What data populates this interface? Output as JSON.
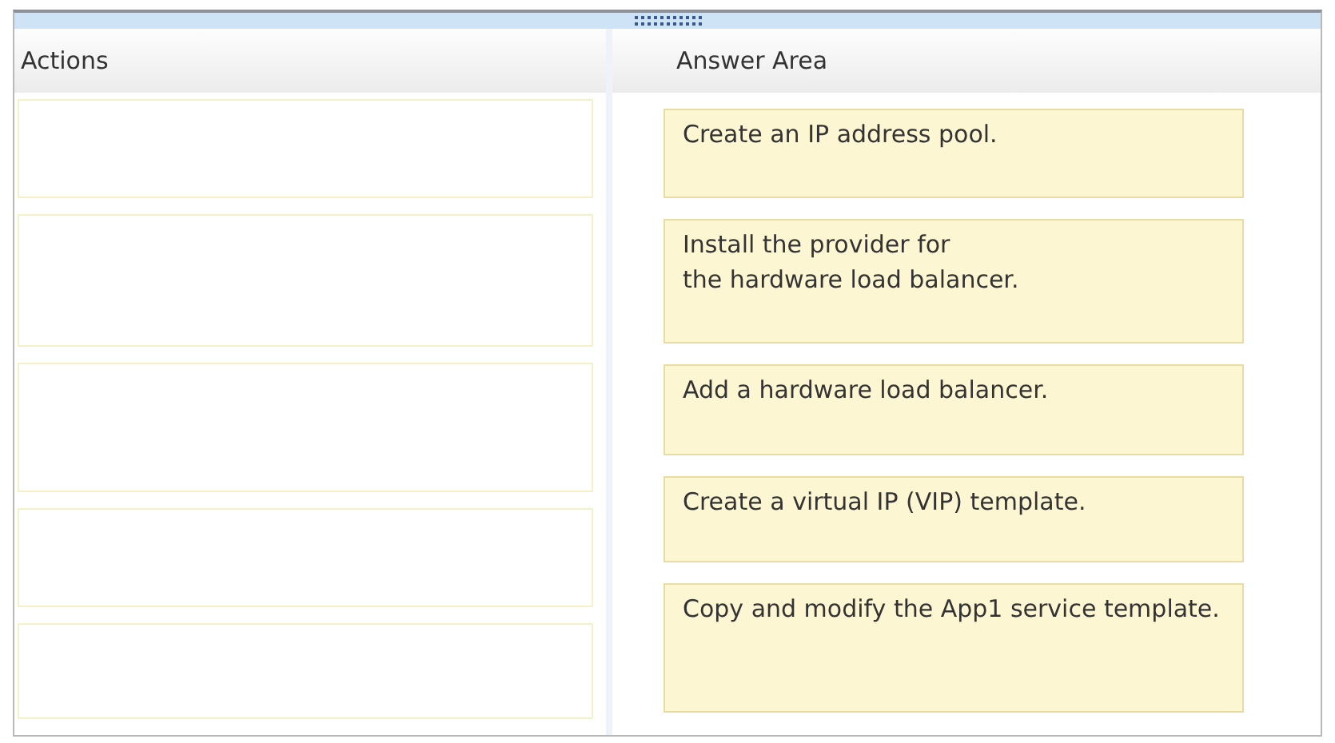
{
  "actions": {
    "title": "Actions",
    "slots": [
      {
        "kind": "drop-slot"
      },
      {
        "kind": "drop-slot"
      },
      {
        "kind": "drop-slot"
      },
      {
        "kind": "drop-slot"
      },
      {
        "kind": "drop-slot"
      }
    ]
  },
  "answer_area": {
    "title": "Answer Area",
    "items": [
      {
        "text": "Create an IP address pool."
      },
      {
        "text": "Install the provider for\nthe hardware load balancer."
      },
      {
        "text": "Add a hardware load balancer."
      },
      {
        "text": "Create a virtual IP (VIP) template."
      },
      {
        "text": "Copy and modify the App1 service template."
      }
    ]
  }
}
